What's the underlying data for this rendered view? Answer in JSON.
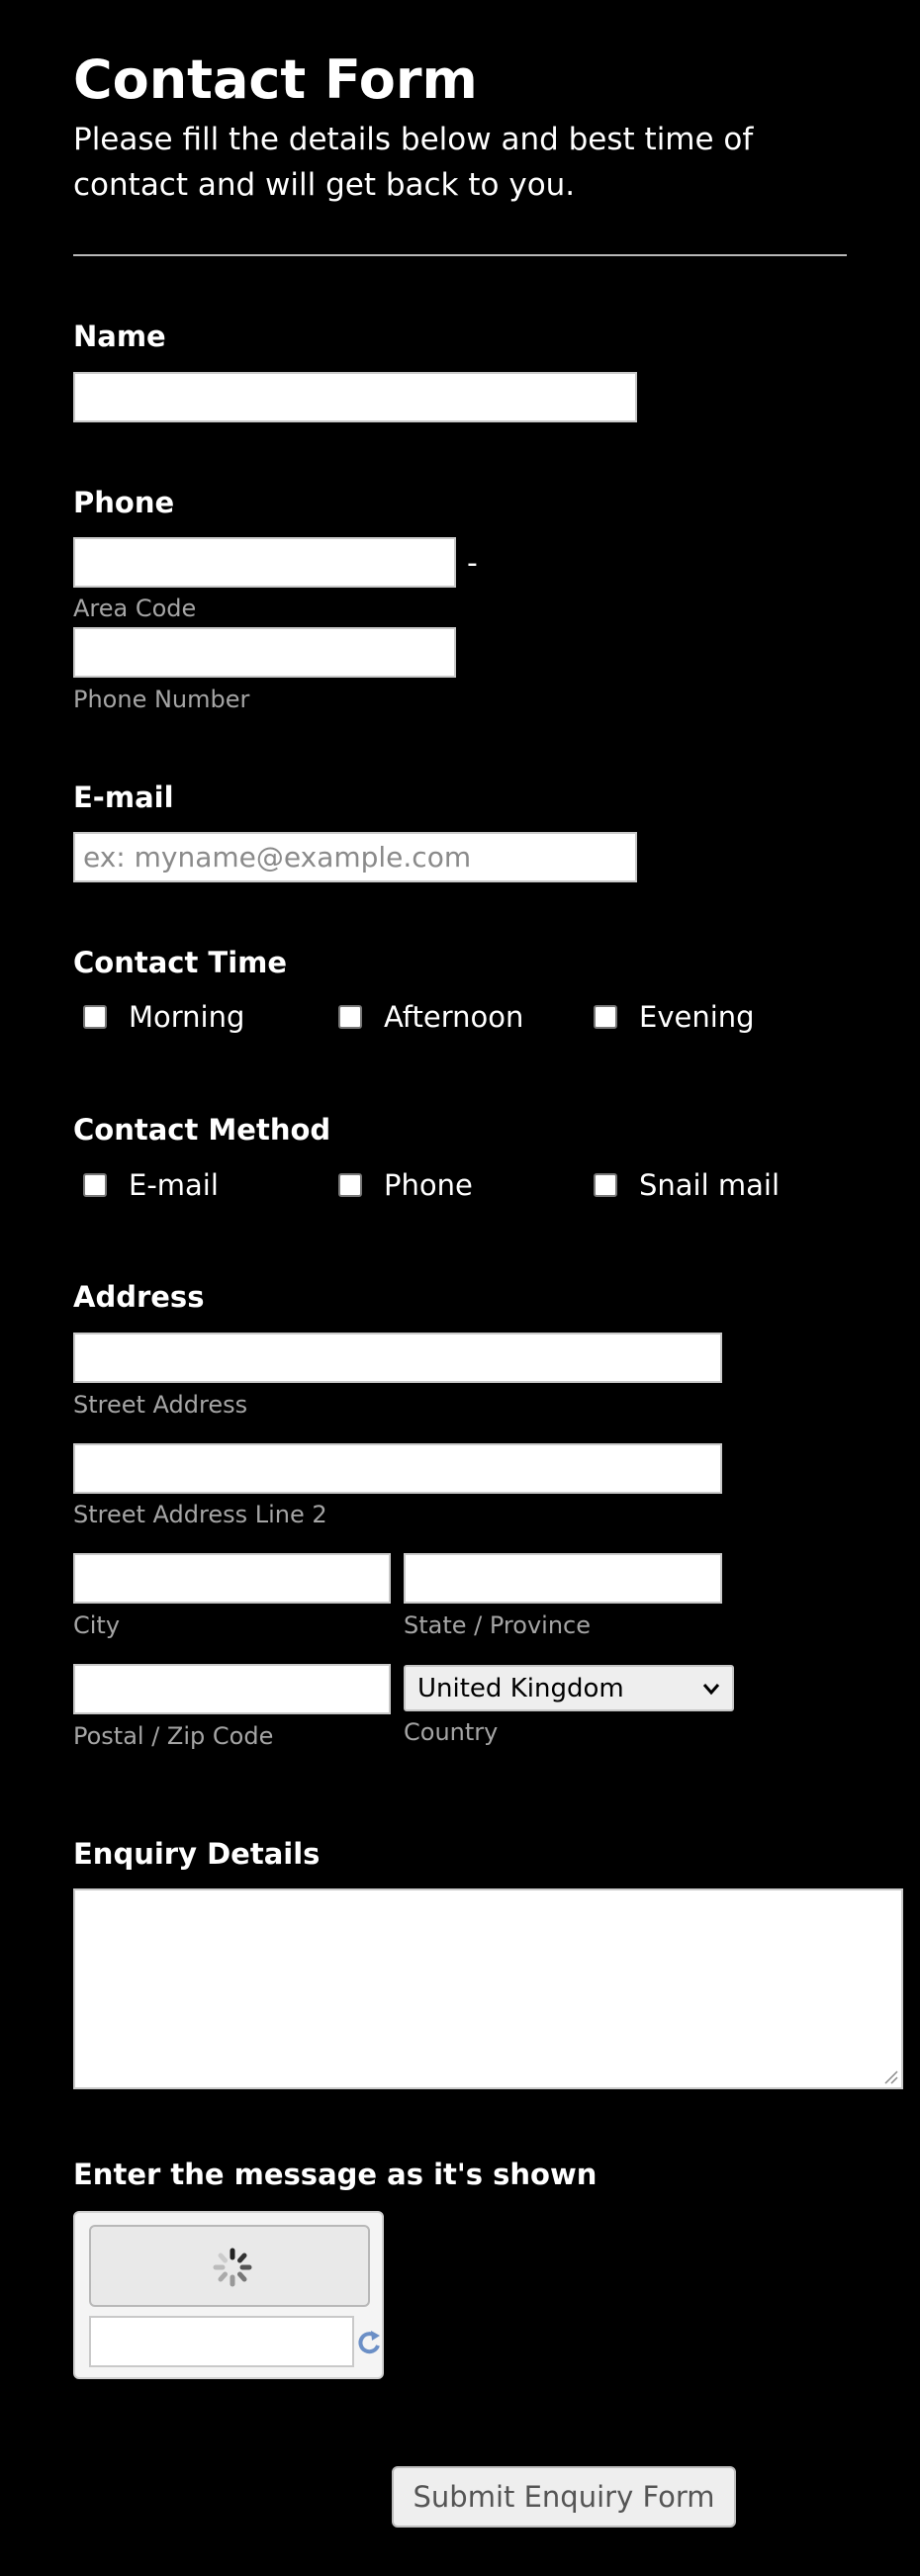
{
  "header": {
    "title": "Contact Form",
    "subtitle": "Please fill the details below and best time of contact and will get back to you."
  },
  "name": {
    "label": "Name",
    "value": ""
  },
  "phone": {
    "label": "Phone",
    "separator": "-",
    "area_code_label": "Area Code",
    "number_label": "Phone Number",
    "area_code_value": "",
    "number_value": ""
  },
  "email": {
    "label": "E-mail",
    "placeholder": "ex: myname@example.com",
    "value": ""
  },
  "contact_time": {
    "label": "Contact Time",
    "options": [
      {
        "label": "Morning",
        "checked": false
      },
      {
        "label": "Afternoon",
        "checked": false
      },
      {
        "label": "Evening",
        "checked": false
      }
    ]
  },
  "contact_method": {
    "label": "Contact Method",
    "options": [
      {
        "label": "E-mail",
        "checked": false
      },
      {
        "label": "Phone",
        "checked": false
      },
      {
        "label": "Snail mail",
        "checked": false
      }
    ]
  },
  "address": {
    "label": "Address",
    "street_label": "Street Address",
    "street2_label": "Street Address Line 2",
    "city_label": "City",
    "state_label": "State / Province",
    "postal_label": "Postal / Zip Code",
    "country_label": "Country",
    "country_value": "United Kingdom"
  },
  "enquiry": {
    "label": "Enquiry Details",
    "value": ""
  },
  "captcha": {
    "label": "Enter the message as it's shown",
    "icons": [
      "loading-spinner-icon",
      "refresh-icon"
    ]
  },
  "submit": {
    "label": "Submit Enquiry Form"
  },
  "icons": {
    "select": "chevron-down-icon",
    "textarea": "resize-handle-icon"
  }
}
